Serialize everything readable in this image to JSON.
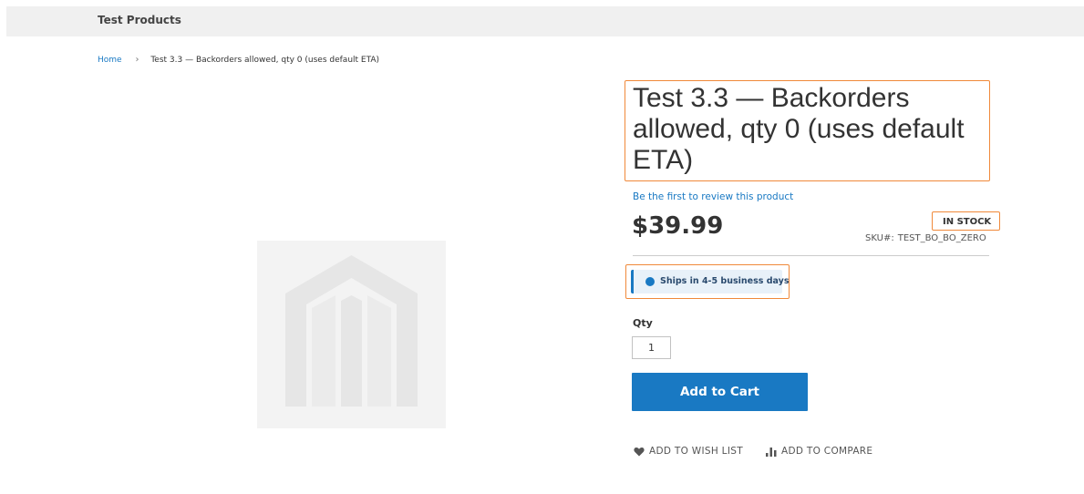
{
  "header": {
    "category": "Test Products"
  },
  "breadcrumb": {
    "home": "Home",
    "separator": "›",
    "current": "Test 3.3 — Backorders allowed, qty 0 (uses default ETA)"
  },
  "product": {
    "title": "Test 3.3 — Backorders allowed, qty 0 (uses default ETA)",
    "review_link": "Be the first to review this product",
    "price": "$39.99",
    "stock_status": "IN STOCK",
    "sku_label": "SKU#:",
    "sku_value": "TEST_BO_BO_ZERO",
    "shipping_notice": "Ships in 4-5 business days"
  },
  "purchase": {
    "qty_label": "Qty",
    "qty_value": "1",
    "add_to_cart_label": "Add to Cart"
  },
  "actions": {
    "wishlist_label": "ADD TO WISH LIST",
    "compare_label": "ADD TO COMPARE"
  },
  "colors": {
    "accent": "#1979c3",
    "highlight": "#f0893a",
    "header_bg": "#f0f0f0"
  },
  "icons": [
    "breadcrumb-chevron-icon",
    "placeholder-logo-icon",
    "heart-icon",
    "compare-bars-icon"
  ]
}
